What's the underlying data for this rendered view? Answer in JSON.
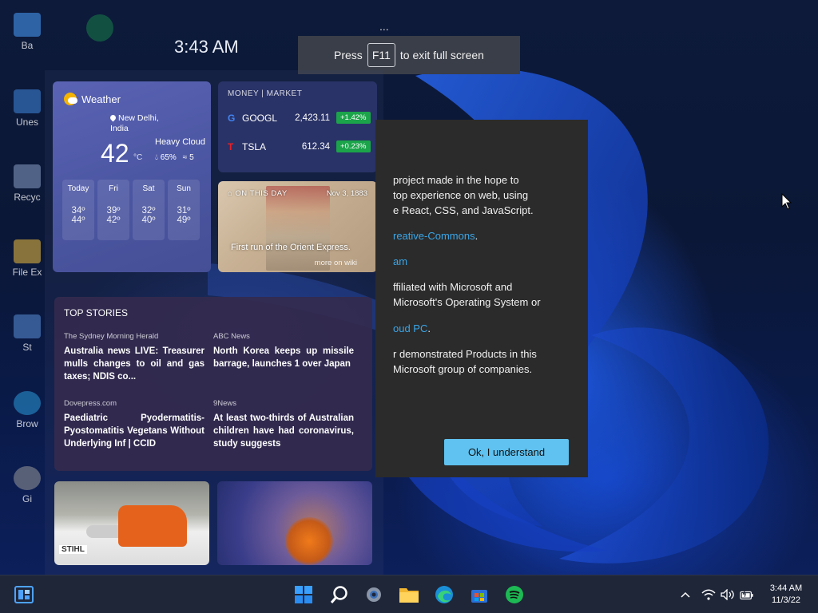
{
  "desktop": {
    "clock": "3:43 AM",
    "icons": [
      "Ba",
      "Unes",
      "Recyc",
      "File Ex",
      "St",
      "Brow",
      "Gi"
    ]
  },
  "fullscreen_tip": {
    "prefix": "Press",
    "key": "F11",
    "suffix": "to exit full screen",
    "dots": "..."
  },
  "weather": {
    "title": "Weather",
    "location_line1": "New Delhi,",
    "location_line2": "India",
    "temp": "42",
    "unit": "°C",
    "condition": "Heavy Cloud",
    "humidity": "65%",
    "wind": "5",
    "days": [
      {
        "day": "Today",
        "hi": "34º",
        "lo": "44º"
      },
      {
        "day": "Fri",
        "hi": "39º",
        "lo": "42º"
      },
      {
        "day": "Sat",
        "hi": "32º",
        "lo": "40º"
      },
      {
        "day": "Sun",
        "hi": "31º",
        "lo": "49º"
      }
    ]
  },
  "money": {
    "header": "MONEY | MARKET",
    "stocks": [
      {
        "logo": "G",
        "logo_color": "#4285f4",
        "symbol": "GOOGL",
        "price": "2,423.11",
        "change": "+1.42%"
      },
      {
        "logo": "T",
        "logo_color": "#e82127",
        "symbol": "TSLA",
        "price": "612.34",
        "change": "+0.23%"
      }
    ],
    "up_color": "#1ba44a"
  },
  "on_this_day": {
    "label": "ON THIS DAY",
    "date": "Nov 3, 1883",
    "caption": "First run of the Orient Express.",
    "more": "more on wiki"
  },
  "top_stories": {
    "header": "TOP STORIES",
    "items": [
      {
        "source": "The Sydney Morning Herald",
        "headline": "Australia news LIVE: Treasurer mulls changes to oil and gas taxes; NDIS co..."
      },
      {
        "source": "ABC News",
        "headline": "North Korea keeps up missile barrage, launches 1 over Japan"
      },
      {
        "source": "Dovepress.com",
        "headline": "Paediatric Pyodermatitis-Pyostomatitis Vegetans Without Underlying Inf | CCID"
      },
      {
        "source": "9News",
        "headline": "At least two-thirds of Australian children have had coronavirus, study suggests"
      }
    ]
  },
  "tiles": {
    "chainsaw_brand": "STIHL"
  },
  "dialog": {
    "para1_lines": [
      "project made in the hope to",
      "top experience on web, using",
      "e React, CSS, and JavaScript."
    ],
    "link1": "reative-Commons",
    "link1_suffix": ".",
    "link2": "am",
    "para2_lines": [
      "ffiliated with Microsoft and",
      "Microsoft's Operating System or"
    ],
    "link3": "oud PC",
    "link3_suffix": ".",
    "para3_lines": [
      "r demonstrated Products in this",
      "Microsoft group of companies."
    ],
    "button": "Ok, I understand",
    "accent": "#5fc2f0"
  },
  "taskbar": {
    "apps": [
      "widgets-icon",
      "start-icon",
      "search-icon",
      "settings-icon",
      "file-explorer-icon",
      "edge-icon",
      "store-icon",
      "spotify-icon"
    ],
    "tray": [
      "chevron-up-icon",
      "wifi-icon",
      "volume-icon",
      "battery-icon"
    ],
    "time": "3:44 AM",
    "date": "11/3/22"
  }
}
